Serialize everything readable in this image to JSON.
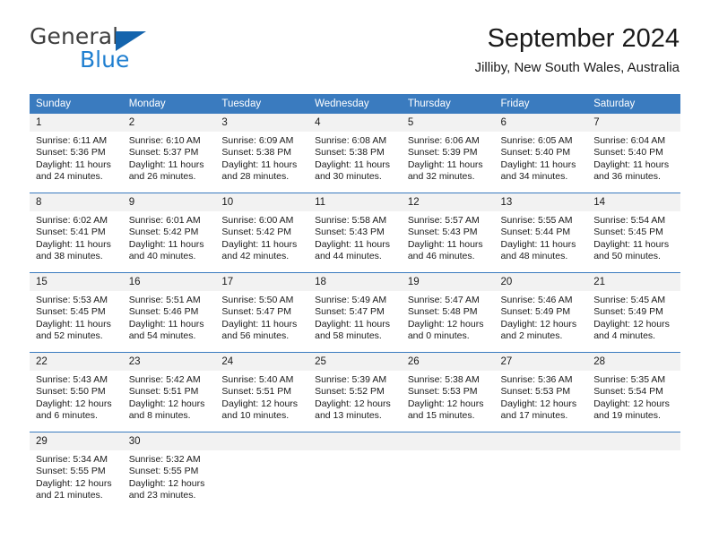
{
  "brand": {
    "name_part1": "General",
    "name_part2": "Blue",
    "triangle_color": "#1464ad",
    "blue_color": "#1f7fd0"
  },
  "header": {
    "title": "September 2024",
    "subtitle": "Jilliby, New South Wales, Australia"
  },
  "theme": {
    "header_blue": "#3a7bbf",
    "daynum_band": "#f2f2f2",
    "text": "#1a1a1a"
  },
  "weekdays": [
    "Sunday",
    "Monday",
    "Tuesday",
    "Wednesday",
    "Thursday",
    "Friday",
    "Saturday"
  ],
  "weeks": [
    [
      {
        "day": "1",
        "sunrise": "Sunrise: 6:11 AM",
        "sunset": "Sunset: 5:36 PM",
        "daylight1": "Daylight: 11 hours",
        "daylight2": "and 24 minutes."
      },
      {
        "day": "2",
        "sunrise": "Sunrise: 6:10 AM",
        "sunset": "Sunset: 5:37 PM",
        "daylight1": "Daylight: 11 hours",
        "daylight2": "and 26 minutes."
      },
      {
        "day": "3",
        "sunrise": "Sunrise: 6:09 AM",
        "sunset": "Sunset: 5:38 PM",
        "daylight1": "Daylight: 11 hours",
        "daylight2": "and 28 minutes."
      },
      {
        "day": "4",
        "sunrise": "Sunrise: 6:08 AM",
        "sunset": "Sunset: 5:38 PM",
        "daylight1": "Daylight: 11 hours",
        "daylight2": "and 30 minutes."
      },
      {
        "day": "5",
        "sunrise": "Sunrise: 6:06 AM",
        "sunset": "Sunset: 5:39 PM",
        "daylight1": "Daylight: 11 hours",
        "daylight2": "and 32 minutes."
      },
      {
        "day": "6",
        "sunrise": "Sunrise: 6:05 AM",
        "sunset": "Sunset: 5:40 PM",
        "daylight1": "Daylight: 11 hours",
        "daylight2": "and 34 minutes."
      },
      {
        "day": "7",
        "sunrise": "Sunrise: 6:04 AM",
        "sunset": "Sunset: 5:40 PM",
        "daylight1": "Daylight: 11 hours",
        "daylight2": "and 36 minutes."
      }
    ],
    [
      {
        "day": "8",
        "sunrise": "Sunrise: 6:02 AM",
        "sunset": "Sunset: 5:41 PM",
        "daylight1": "Daylight: 11 hours",
        "daylight2": "and 38 minutes."
      },
      {
        "day": "9",
        "sunrise": "Sunrise: 6:01 AM",
        "sunset": "Sunset: 5:42 PM",
        "daylight1": "Daylight: 11 hours",
        "daylight2": "and 40 minutes."
      },
      {
        "day": "10",
        "sunrise": "Sunrise: 6:00 AM",
        "sunset": "Sunset: 5:42 PM",
        "daylight1": "Daylight: 11 hours",
        "daylight2": "and 42 minutes."
      },
      {
        "day": "11",
        "sunrise": "Sunrise: 5:58 AM",
        "sunset": "Sunset: 5:43 PM",
        "daylight1": "Daylight: 11 hours",
        "daylight2": "and 44 minutes."
      },
      {
        "day": "12",
        "sunrise": "Sunrise: 5:57 AM",
        "sunset": "Sunset: 5:43 PM",
        "daylight1": "Daylight: 11 hours",
        "daylight2": "and 46 minutes."
      },
      {
        "day": "13",
        "sunrise": "Sunrise: 5:55 AM",
        "sunset": "Sunset: 5:44 PM",
        "daylight1": "Daylight: 11 hours",
        "daylight2": "and 48 minutes."
      },
      {
        "day": "14",
        "sunrise": "Sunrise: 5:54 AM",
        "sunset": "Sunset: 5:45 PM",
        "daylight1": "Daylight: 11 hours",
        "daylight2": "and 50 minutes."
      }
    ],
    [
      {
        "day": "15",
        "sunrise": "Sunrise: 5:53 AM",
        "sunset": "Sunset: 5:45 PM",
        "daylight1": "Daylight: 11 hours",
        "daylight2": "and 52 minutes."
      },
      {
        "day": "16",
        "sunrise": "Sunrise: 5:51 AM",
        "sunset": "Sunset: 5:46 PM",
        "daylight1": "Daylight: 11 hours",
        "daylight2": "and 54 minutes."
      },
      {
        "day": "17",
        "sunrise": "Sunrise: 5:50 AM",
        "sunset": "Sunset: 5:47 PM",
        "daylight1": "Daylight: 11 hours",
        "daylight2": "and 56 minutes."
      },
      {
        "day": "18",
        "sunrise": "Sunrise: 5:49 AM",
        "sunset": "Sunset: 5:47 PM",
        "daylight1": "Daylight: 11 hours",
        "daylight2": "and 58 minutes."
      },
      {
        "day": "19",
        "sunrise": "Sunrise: 5:47 AM",
        "sunset": "Sunset: 5:48 PM",
        "daylight1": "Daylight: 12 hours",
        "daylight2": "and 0 minutes."
      },
      {
        "day": "20",
        "sunrise": "Sunrise: 5:46 AM",
        "sunset": "Sunset: 5:49 PM",
        "daylight1": "Daylight: 12 hours",
        "daylight2": "and 2 minutes."
      },
      {
        "day": "21",
        "sunrise": "Sunrise: 5:45 AM",
        "sunset": "Sunset: 5:49 PM",
        "daylight1": "Daylight: 12 hours",
        "daylight2": "and 4 minutes."
      }
    ],
    [
      {
        "day": "22",
        "sunrise": "Sunrise: 5:43 AM",
        "sunset": "Sunset: 5:50 PM",
        "daylight1": "Daylight: 12 hours",
        "daylight2": "and 6 minutes."
      },
      {
        "day": "23",
        "sunrise": "Sunrise: 5:42 AM",
        "sunset": "Sunset: 5:51 PM",
        "daylight1": "Daylight: 12 hours",
        "daylight2": "and 8 minutes."
      },
      {
        "day": "24",
        "sunrise": "Sunrise: 5:40 AM",
        "sunset": "Sunset: 5:51 PM",
        "daylight1": "Daylight: 12 hours",
        "daylight2": "and 10 minutes."
      },
      {
        "day": "25",
        "sunrise": "Sunrise: 5:39 AM",
        "sunset": "Sunset: 5:52 PM",
        "daylight1": "Daylight: 12 hours",
        "daylight2": "and 13 minutes."
      },
      {
        "day": "26",
        "sunrise": "Sunrise: 5:38 AM",
        "sunset": "Sunset: 5:53 PM",
        "daylight1": "Daylight: 12 hours",
        "daylight2": "and 15 minutes."
      },
      {
        "day": "27",
        "sunrise": "Sunrise: 5:36 AM",
        "sunset": "Sunset: 5:53 PM",
        "daylight1": "Daylight: 12 hours",
        "daylight2": "and 17 minutes."
      },
      {
        "day": "28",
        "sunrise": "Sunrise: 5:35 AM",
        "sunset": "Sunset: 5:54 PM",
        "daylight1": "Daylight: 12 hours",
        "daylight2": "and 19 minutes."
      }
    ],
    [
      {
        "day": "29",
        "sunrise": "Sunrise: 5:34 AM",
        "sunset": "Sunset: 5:55 PM",
        "daylight1": "Daylight: 12 hours",
        "daylight2": "and 21 minutes."
      },
      {
        "day": "30",
        "sunrise": "Sunrise: 5:32 AM",
        "sunset": "Sunset: 5:55 PM",
        "daylight1": "Daylight: 12 hours",
        "daylight2": "and 23 minutes."
      },
      {
        "day": "",
        "sunrise": "",
        "sunset": "",
        "daylight1": "",
        "daylight2": ""
      },
      {
        "day": "",
        "sunrise": "",
        "sunset": "",
        "daylight1": "",
        "daylight2": ""
      },
      {
        "day": "",
        "sunrise": "",
        "sunset": "",
        "daylight1": "",
        "daylight2": ""
      },
      {
        "day": "",
        "sunrise": "",
        "sunset": "",
        "daylight1": "",
        "daylight2": ""
      },
      {
        "day": "",
        "sunrise": "",
        "sunset": "",
        "daylight1": "",
        "daylight2": ""
      }
    ]
  ]
}
